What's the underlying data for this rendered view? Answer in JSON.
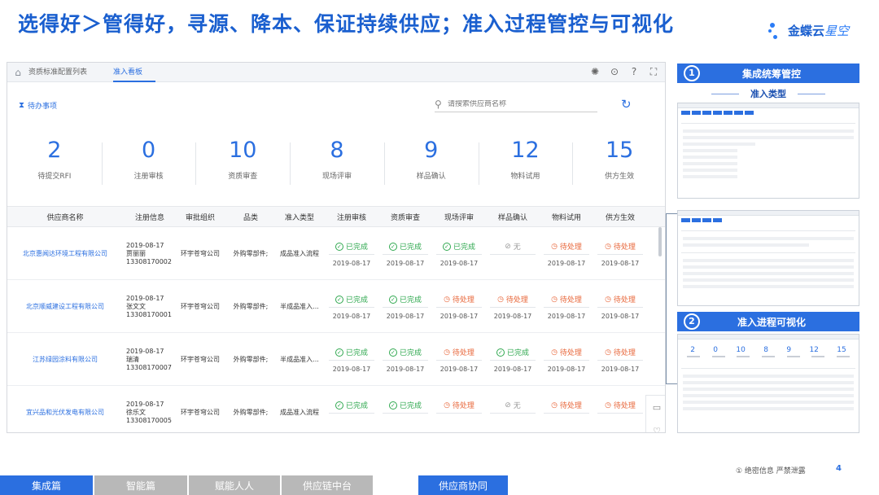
{
  "slide": {
    "title": "选得好＞管得好，寻源、降本、保证持续供应；准入过程管控与可视化",
    "brand_main": "金蝶云",
    "brand_sub": "星空",
    "confidential": "① 绝密信息 严禁泄露",
    "page_number": "4"
  },
  "app": {
    "breadcrumbs": [
      "资质标准配置列表",
      "准入看板"
    ],
    "pending_title": "待办事项",
    "search_placeholder": "请搜索供应商名称",
    "stats": [
      {
        "value": "2",
        "label": "待提交RFI"
      },
      {
        "value": "0",
        "label": "注册审核"
      },
      {
        "value": "10",
        "label": "资质审查"
      },
      {
        "value": "8",
        "label": "现场评审"
      },
      {
        "value": "9",
        "label": "样品确认"
      },
      {
        "value": "12",
        "label": "物料试用"
      },
      {
        "value": "15",
        "label": "供方生效"
      }
    ],
    "columns": [
      "供应商名称",
      "注册信息",
      "审批组织",
      "品类",
      "准入类型",
      "注册审核",
      "资质审查",
      "现场评审",
      "样品确认",
      "物料试用",
      "供方生效"
    ],
    "rows": [
      {
        "supplier": "北京惠闻达环境工程有限公司",
        "reg_date": "2019-08-17",
        "reg_name": "贾丽丽",
        "reg_phone": "13308170002",
        "org": "环宇苍穹公司",
        "category": "外购零部件;",
        "type": "成品准入流程",
        "statuses": [
          {
            "text": "已完成",
            "kind": "done",
            "date": "2019-08-17"
          },
          {
            "text": "已完成",
            "kind": "done",
            "date": "2019-08-17"
          },
          {
            "text": "已完成",
            "kind": "done",
            "date": "2019-08-17"
          },
          {
            "text": "无",
            "kind": "none",
            "date": ""
          },
          {
            "text": "待处理",
            "kind": "wait",
            "date": "2019-08-17"
          },
          {
            "text": "待处理",
            "kind": "wait",
            "date": "2019-08-17"
          }
        ]
      },
      {
        "supplier": "北京顺威建设工程有限公司",
        "reg_date": "2019-08-17",
        "reg_name": "张文文",
        "reg_phone": "13308170001",
        "org": "环宇苍穹公司",
        "category": "外购零部件;",
        "type": "半成品准入...",
        "statuses": [
          {
            "text": "已完成",
            "kind": "done",
            "date": "2019-08-17"
          },
          {
            "text": "已完成",
            "kind": "done",
            "date": "2019-08-17"
          },
          {
            "text": "待处理",
            "kind": "wait",
            "date": "2019-08-17"
          },
          {
            "text": "待处理",
            "kind": "wait",
            "date": "2019-08-17"
          },
          {
            "text": "待处理",
            "kind": "wait",
            "date": "2019-08-17"
          },
          {
            "text": "待处理",
            "kind": "wait",
            "date": "2019-08-17"
          }
        ]
      },
      {
        "supplier": "江苏绿园涂料有限公司",
        "reg_date": "2019-08-17",
        "reg_name": "瑞清",
        "reg_phone": "13308170007",
        "org": "环宇苍穹公司",
        "category": "外购零部件;",
        "type": "半成品准入...",
        "statuses": [
          {
            "text": "已完成",
            "kind": "done",
            "date": "2019-08-17"
          },
          {
            "text": "已完成",
            "kind": "done",
            "date": "2019-08-17"
          },
          {
            "text": "待处理",
            "kind": "wait",
            "date": "2019-08-17"
          },
          {
            "text": "已完成",
            "kind": "done",
            "date": "2019-08-17"
          },
          {
            "text": "待处理",
            "kind": "wait",
            "date": "2019-08-17"
          },
          {
            "text": "待处理",
            "kind": "wait",
            "date": "2019-08-17"
          }
        ]
      },
      {
        "supplier": "宜兴品和光伏发电有限公司",
        "reg_date": "2019-08-17",
        "reg_name": "徐乐文",
        "reg_phone": "13308170005",
        "org": "环宇苍穹公司",
        "category": "外购零部件;",
        "type": "成品准入流程",
        "statuses": [
          {
            "text": "已完成",
            "kind": "done",
            "date": ""
          },
          {
            "text": "已完成",
            "kind": "done",
            "date": ""
          },
          {
            "text": "待处理",
            "kind": "wait",
            "date": ""
          },
          {
            "text": "无",
            "kind": "none",
            "date": ""
          },
          {
            "text": "待处理",
            "kind": "wait",
            "date": ""
          },
          {
            "text": "待处理",
            "kind": "wait",
            "date": ""
          }
        ]
      }
    ]
  },
  "panels": {
    "p1_num": "1",
    "p1_title": "集成统筹管控",
    "p1_subtitle": "准入类型",
    "p2_num": "2",
    "p2_title": "准入进程可视化",
    "p2_stats": [
      "2",
      "0",
      "10",
      "8",
      "9",
      "12",
      "15"
    ]
  },
  "footer": {
    "tabs": [
      {
        "label": "集成篇",
        "active": true
      },
      {
        "label": "智能篇",
        "active": false
      },
      {
        "label": "赋能人人",
        "active": false
      },
      {
        "label": "供应链中台",
        "active": false
      },
      {
        "label": "供应商协同",
        "active": true
      }
    ]
  },
  "colors": {
    "accent": "#2b6fe0",
    "done": "#2fa84f",
    "wait": "#e8683c",
    "none": "#999999",
    "footer_inactive": "#b8b8b8"
  }
}
